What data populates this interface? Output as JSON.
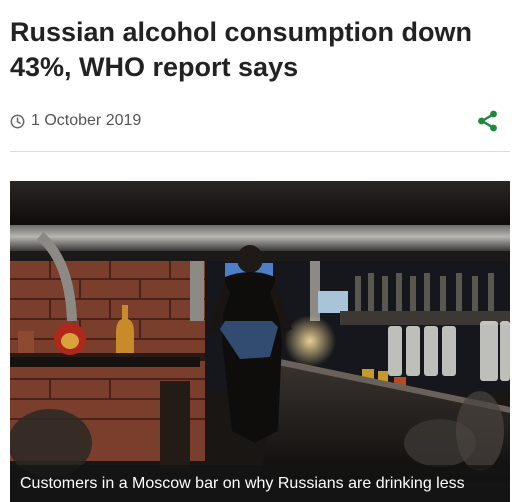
{
  "article": {
    "headline": "Russian alcohol consumption down 43%, WHO report says",
    "date": "1 October 2019"
  },
  "icons": {
    "date": "clock-icon",
    "share": "share-icon"
  },
  "media": {
    "type": "video-still",
    "caption": "Customers in a Moscow bar on why Russians are drinking less"
  },
  "colors": {
    "share_accent": "#1b8a3a",
    "caption_bg": "#141414",
    "divider": "#dddddd"
  }
}
